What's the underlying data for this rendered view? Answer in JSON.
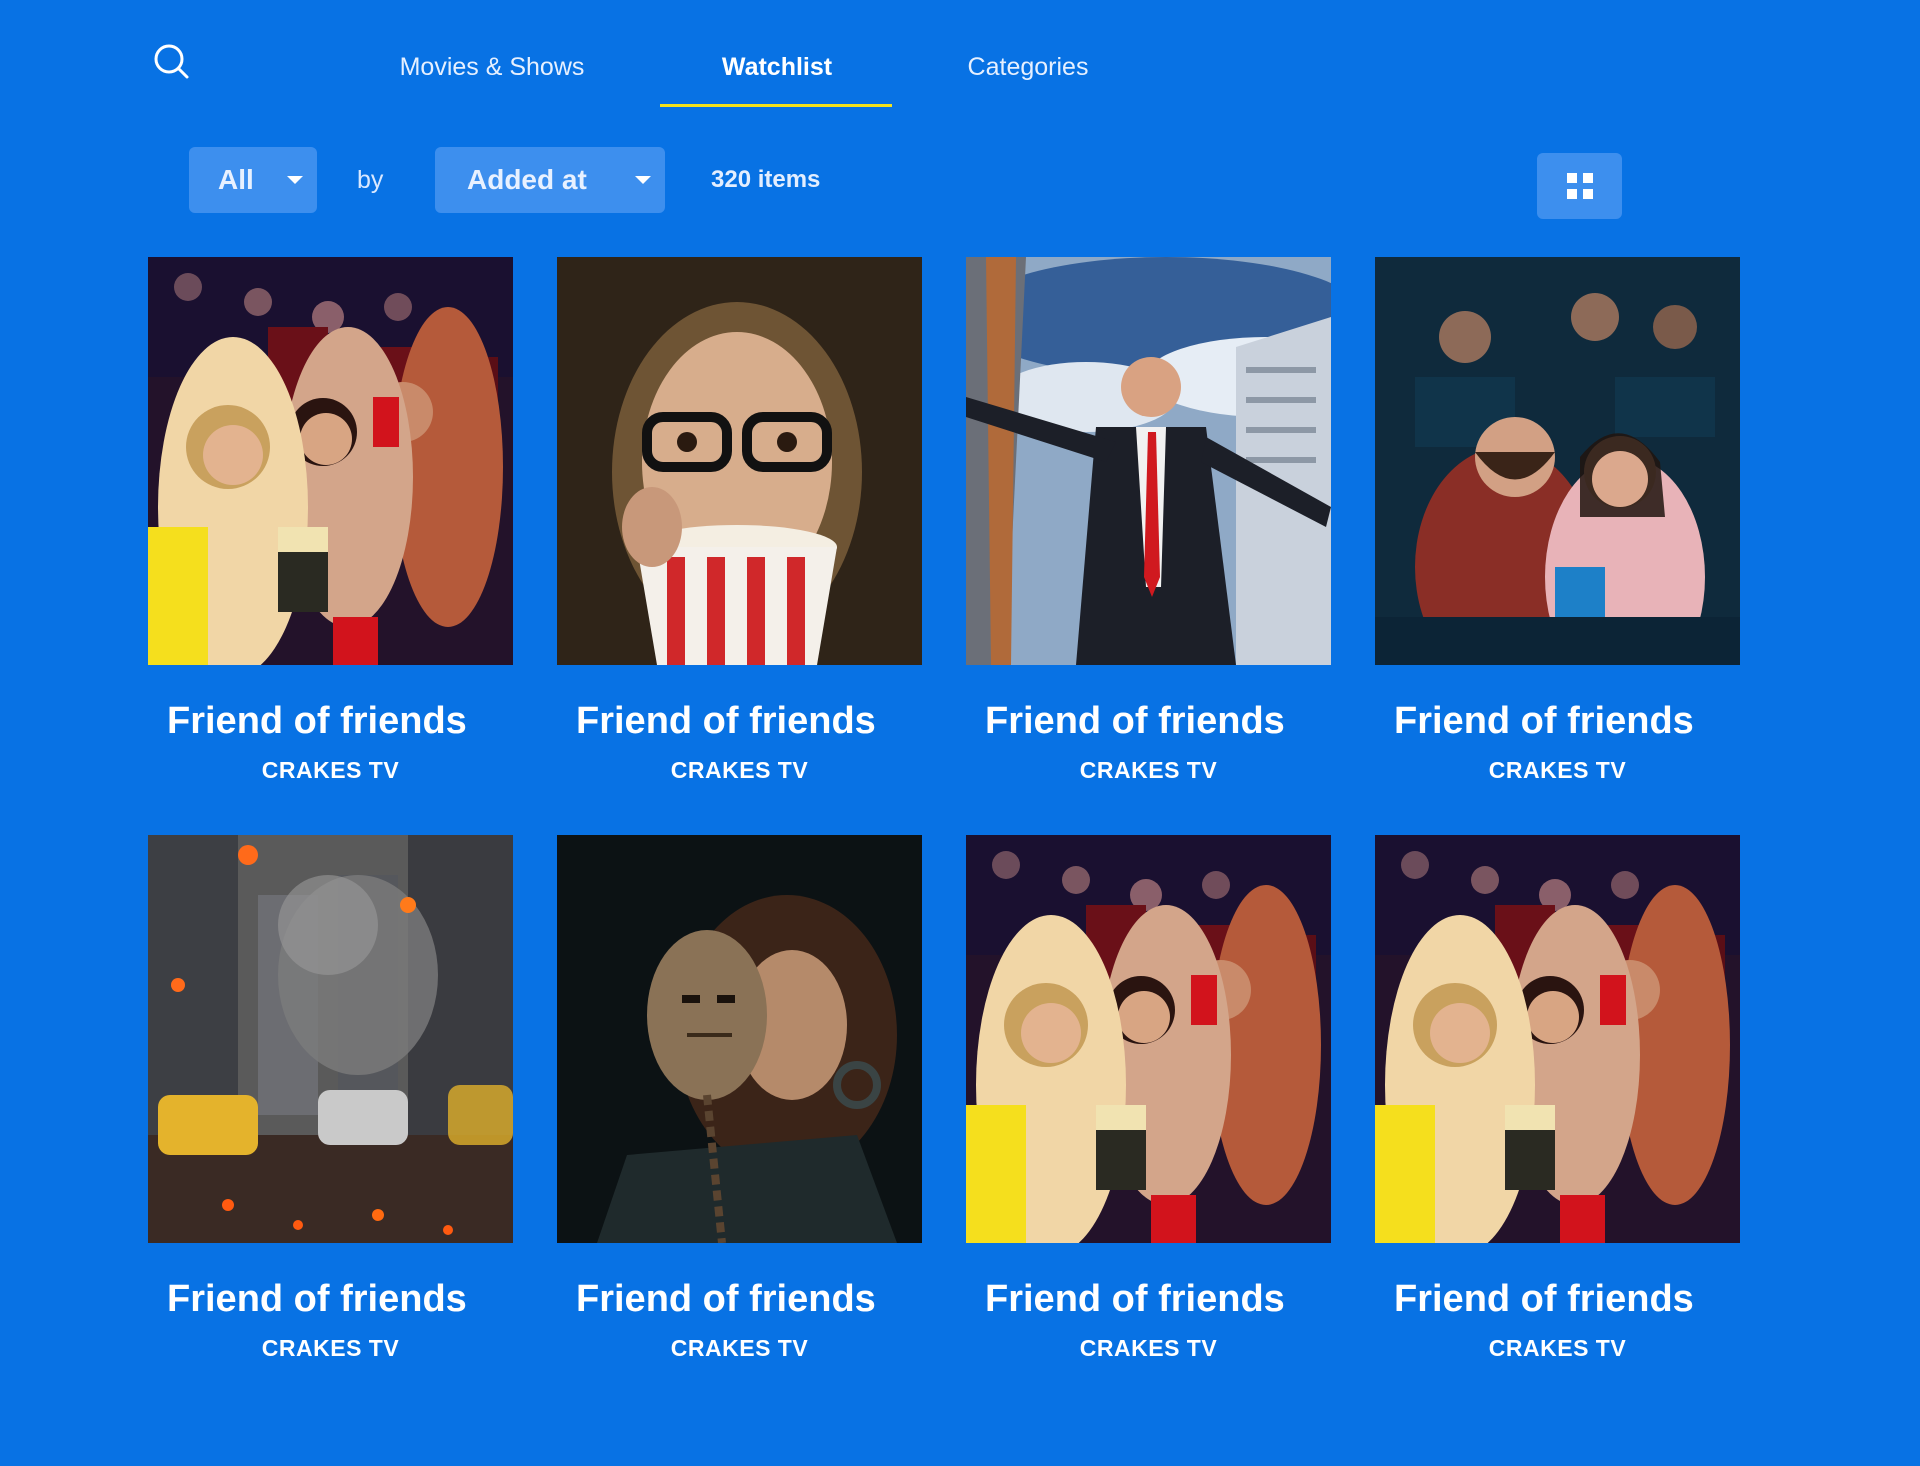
{
  "nav": {
    "search_icon": "search-icon",
    "tabs": [
      {
        "label": "Movies & Shows",
        "active": false
      },
      {
        "label": "Watchlist",
        "active": true
      },
      {
        "label": "Categories",
        "active": false
      }
    ],
    "underline_color": "#f4e21c"
  },
  "filters": {
    "type_value": "All",
    "by_label": "by",
    "sort_value": "Added at",
    "count_label": "320 items",
    "view_icon": "grid-view-icon"
  },
  "theme": {
    "background": "#0872e4",
    "control_bg": "#3d8fee"
  },
  "items": [
    {
      "title": "Friend of friends",
      "subtitle": "CRAKES TV",
      "poster": "cinema-audience"
    },
    {
      "title": "Friend of friends",
      "subtitle": "CRAKES TV",
      "poster": "woman-popcorn"
    },
    {
      "title": "Friend of friends",
      "subtitle": "CRAKES TV",
      "poster": "agent-skyscraper"
    },
    {
      "title": "Friend of friends",
      "subtitle": "CRAKES TV",
      "poster": "laughing-couple"
    },
    {
      "title": "Friend of friends",
      "subtitle": "CRAKES TV",
      "poster": "burning-city"
    },
    {
      "title": "Friend of friends",
      "subtitle": "CRAKES TV",
      "poster": "masked-woman"
    },
    {
      "title": "Friend of friends",
      "subtitle": "CRAKES TV",
      "poster": "cinema-audience"
    },
    {
      "title": "Friend of friends",
      "subtitle": "CRAKES TV",
      "poster": "cinema-audience"
    }
  ]
}
